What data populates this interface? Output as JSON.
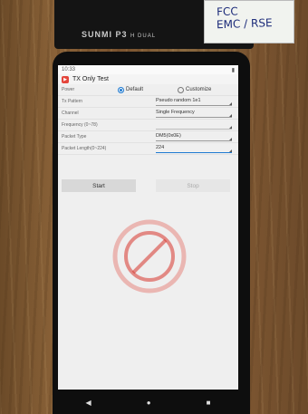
{
  "device": {
    "brand": "SUNMI P3",
    "brand_sub": "H DUAL",
    "sticker_line1": "FCC",
    "sticker_line2": "EMC / RSE"
  },
  "status_bar": {
    "time": "10:33",
    "battery_icon": "battery-icon"
  },
  "app_bar": {
    "title": "TX Only Test",
    "icon": "app-icon"
  },
  "power": {
    "label": "Power",
    "option_default": "Default",
    "option_customize": "Customize",
    "selected": "Default"
  },
  "fields": [
    {
      "label": "Tx Pattern",
      "value": "Pseudo random 1e1"
    },
    {
      "label": "Channel",
      "value": "Single Frequency"
    },
    {
      "label": "Frequency (0~78)",
      "value": ""
    },
    {
      "label": "Packet Type",
      "value": "DM5(0x0E)"
    },
    {
      "label": "Packet Length(0~224)",
      "value": "224"
    }
  ],
  "buttons": {
    "start": "Start",
    "stop": "Stop"
  },
  "nav": {
    "back": "◀",
    "home": "●",
    "recents": "■"
  },
  "colors": {
    "accent": "#1e7ad1",
    "app_icon": "#e4453b",
    "stamp": "#d7342c"
  }
}
